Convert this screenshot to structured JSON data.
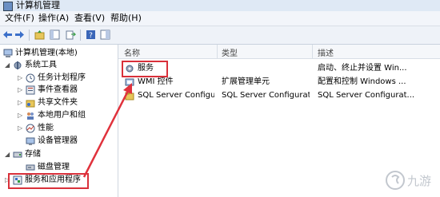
{
  "window": {
    "title": "计算机管理"
  },
  "menu": [
    "文件(F)",
    "操作(A)",
    "查看(V)",
    "帮助(H)"
  ],
  "tree": [
    {
      "label": "计算机管理(本地)"
    },
    {
      "label": "系统工具"
    },
    {
      "label": "任务计划程序"
    },
    {
      "label": "事件查看器"
    },
    {
      "label": "共享文件夹"
    },
    {
      "label": "本地用户和组"
    },
    {
      "label": "性能"
    },
    {
      "label": "设备管理器"
    },
    {
      "label": "存储"
    },
    {
      "label": "磁盘管理"
    },
    {
      "label": "服务和应用程序"
    }
  ],
  "list": {
    "columns": [
      "名称",
      "类型",
      "描述"
    ],
    "rows": [
      {
        "name": "服务",
        "type": "",
        "desc": "启动、终止并设置 Win..."
      },
      {
        "name": "WMI 控件",
        "type": "扩展管理单元",
        "desc": "配置和控制 Windows ..."
      },
      {
        "name": "SQL Server Configu...",
        "type": "SQL Server Configurat...",
        "desc": "SQL Server Configurat..."
      }
    ]
  },
  "colors": {
    "highlight": "#d9303a",
    "arrow": "#e0323c"
  },
  "watermark": {
    "text": "九游"
  }
}
